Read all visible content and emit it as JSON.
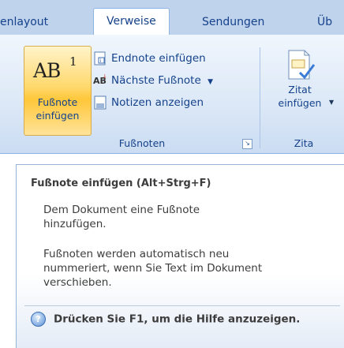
{
  "tabs": [
    {
      "label": "enlayout"
    },
    {
      "label": "Verweise"
    },
    {
      "label": "Sendungen"
    },
    {
      "label": "Üb"
    }
  ],
  "footnote_button": {
    "sup": "1",
    "ab": "AB",
    "line1": "Fußnote",
    "line2": "einfügen"
  },
  "small_buttons": [
    {
      "label": "Endnote einfügen",
      "icon": "endnote-icon"
    },
    {
      "label": "Nächste Fußnote",
      "icon": "next-footnote-icon"
    },
    {
      "label": "Notizen anzeigen",
      "icon": "show-notes-icon"
    }
  ],
  "groups": {
    "footnotes": "Fußnoten",
    "citations": "Zita"
  },
  "cite_button": {
    "line1": "Zitat",
    "line2": "einfügen"
  },
  "tooltip": {
    "title": "Fußnote einfügen (Alt+Strg+F)",
    "p1_line1": "Dem Dokument eine Fußnote",
    "p1_line2": "hinzufügen.",
    "p2_line1": "Fußnoten werden automatisch neu",
    "p2_line2": "nummeriert, wenn Sie Text im Dokument",
    "p2_line3": "verschieben.",
    "help": "Drücken Sie F1, um die Hilfe anzuzeigen."
  }
}
